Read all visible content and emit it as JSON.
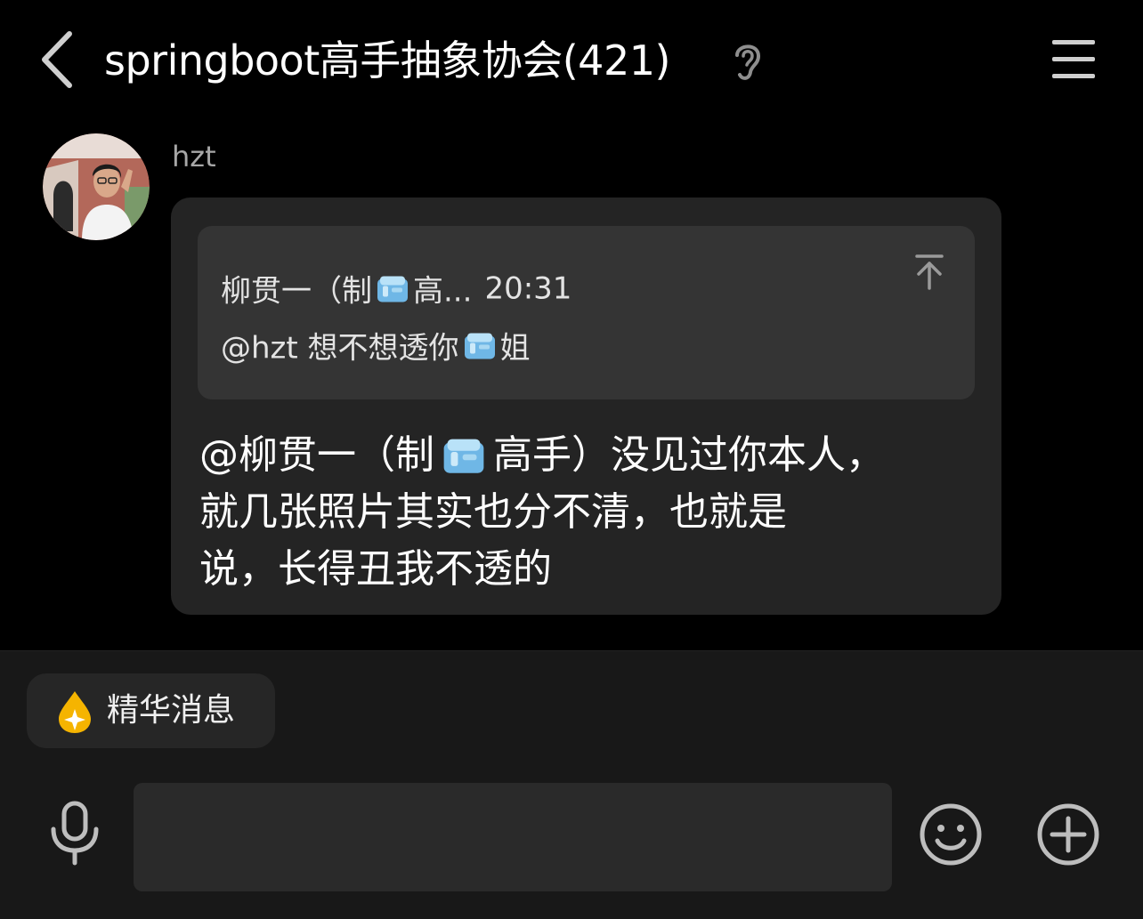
{
  "header": {
    "title": "springboot高手抽象协会(421)",
    "back_icon": "chevron-left-icon",
    "ear_icon": "ear-icon",
    "menu_icon": "menu-icon"
  },
  "message": {
    "sender": "hzt",
    "avatar_icon": "avatar-photo",
    "quote": {
      "name": "柳贯一（制",
      "name_suffix": "高...",
      "time": "20:31",
      "mention": "@hzt 想不想透你",
      "mention_suffix": "姐",
      "jump_icon": "jump-to-top-icon"
    },
    "text_line1_a": "@柳贯一（制",
    "text_line1_b": "高手）没见过你本人，",
    "text_line2": "就几张照片其实也分不清，也就是",
    "text_line3": "说，长得丑我不透的",
    "emoji_icon": "ice-cube-emoji"
  },
  "bottom": {
    "essence_label": "精华消息",
    "essence_icon": "drop-sparkle-icon",
    "input_value": "",
    "input_placeholder": "",
    "mic_icon": "microphone-icon",
    "emoji_button_icon": "smiley-icon",
    "plus_icon": "plus-circle-icon"
  },
  "colors": {
    "background": "#000000",
    "bubble": "#242424",
    "quote": "#343434",
    "bottom_bar": "#181818",
    "input": "#2a2a2a",
    "accent_drop": "#f5b400"
  }
}
